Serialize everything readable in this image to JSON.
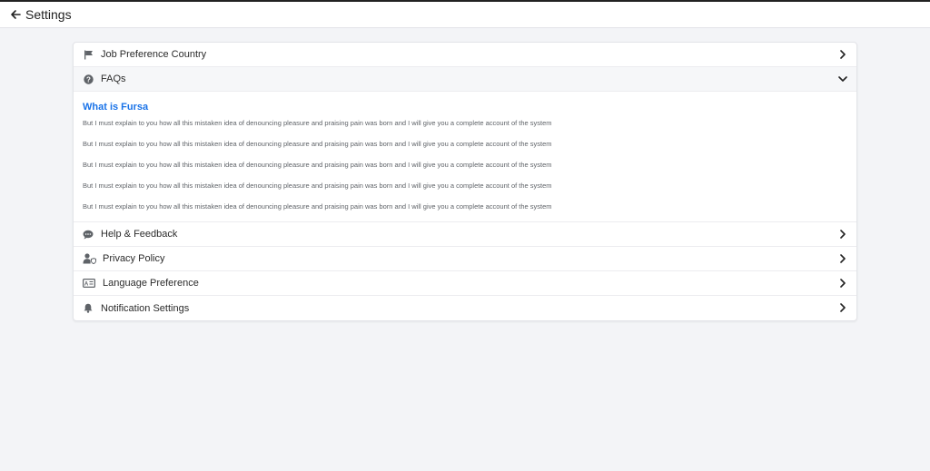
{
  "header": {
    "title": "Settings",
    "back_icon": "arrow-left-icon"
  },
  "settings": {
    "job_country": {
      "label": "Job Preference Country",
      "icon": "flag-icon"
    },
    "faqs": {
      "label": "FAQs",
      "icon": "question-circle-icon",
      "expanded": true,
      "question": "What is Fursa",
      "answers": [
        "But I must explain to you how all this mistaken idea of denouncing pleasure and praising pain was born and I will give you a complete account of the system",
        "But I must explain to you how all this mistaken idea of denouncing pleasure and praising pain was born and I will give you a complete account of the system",
        "But I must explain to you how all this mistaken idea of denouncing pleasure and praising pain was born and I will give you a complete account of the system",
        "But I must explain to you how all this mistaken idea of denouncing pleasure and praising pain was born and I will give you a complete account of the system",
        "But I must explain to you how all this mistaken idea of denouncing pleasure and praising pain was born and I will give you a complete account of the system"
      ]
    },
    "help": {
      "label": "Help & Feedback",
      "icon": "chat-bubble-icon"
    },
    "privacy": {
      "label": "Privacy Policy",
      "icon": "user-shield-icon"
    },
    "language": {
      "label": "Language Preference",
      "icon": "language-card-icon"
    },
    "notifications": {
      "label": "Notification Settings",
      "icon": "bell-icon"
    }
  },
  "colors": {
    "accent": "#1a73e8",
    "background": "#f3f4f7",
    "icon": "#5f6368"
  }
}
